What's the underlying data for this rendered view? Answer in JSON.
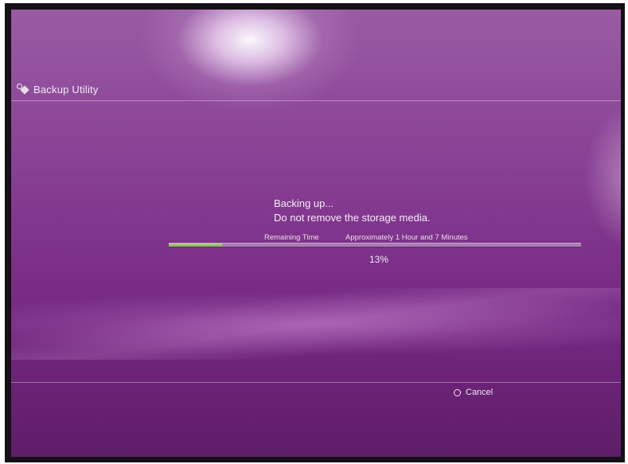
{
  "header": {
    "title": "Backup Utility",
    "icon": "backup-utility-icon"
  },
  "status": {
    "line1": "Backing up...",
    "line2": "Do not remove the storage media."
  },
  "remaining": {
    "label": "Remaining Time",
    "value": "Approximately 1 Hour and 7 Minutes"
  },
  "progress": {
    "percent_text": "13%",
    "fraction": 0.13
  },
  "footer": {
    "cancel_icon": "circle-button-icon",
    "cancel_label": "Cancel"
  },
  "colors": {
    "background": "#7a2d87",
    "progress_fill": "#8fb85a",
    "text": "#f4eaf5"
  }
}
